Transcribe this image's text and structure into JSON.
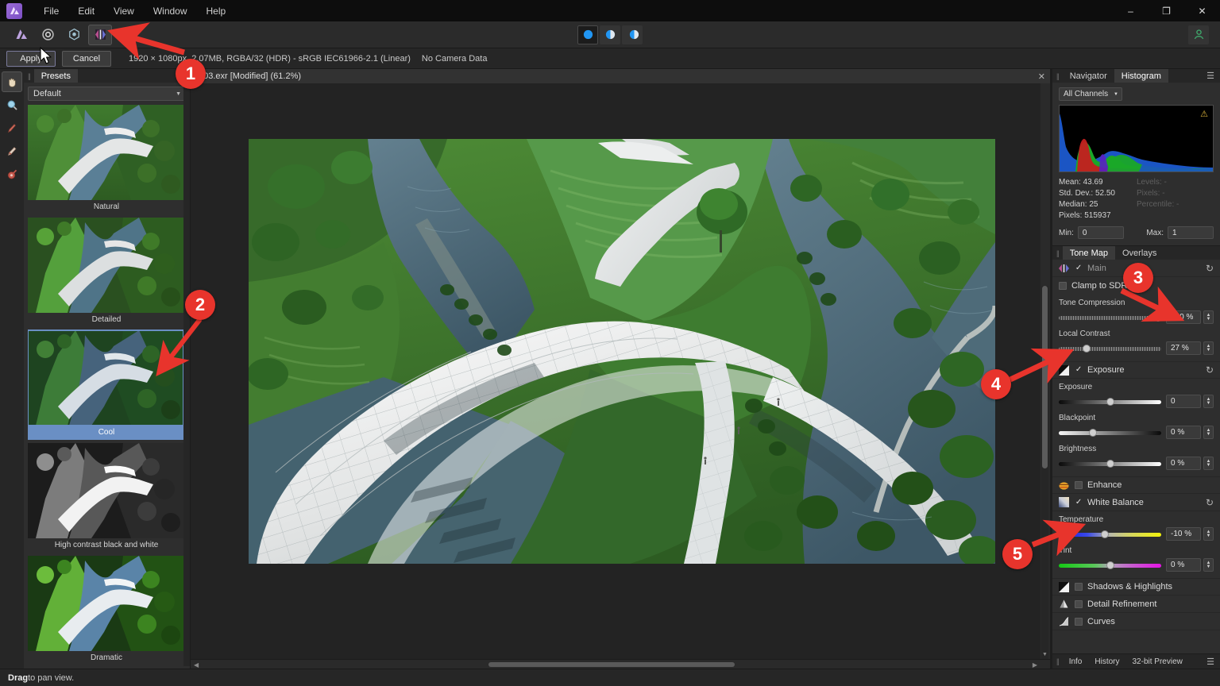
{
  "app": {
    "title": "Affinity Photo",
    "logo_icon": "affinity-photo-logo"
  },
  "menubar": {
    "items": [
      {
        "label": "File"
      },
      {
        "label": "Edit"
      },
      {
        "label": "View"
      },
      {
        "label": "Window"
      },
      {
        "label": "Help"
      }
    ]
  },
  "window_controls": {
    "minimize": "–",
    "maximize": "❐",
    "close": "✕"
  },
  "toolbar": {
    "personas": [
      {
        "name": "photo-persona",
        "icon": "affinity-persona-icon",
        "active": false
      },
      {
        "name": "liquify-persona",
        "icon": "liquify-persona-icon",
        "active": false
      },
      {
        "name": "develop-persona",
        "icon": "develop-persona-icon",
        "active": false
      },
      {
        "name": "tone-mapping-persona",
        "icon": "tone-mapping-persona-icon",
        "active": true
      },
      {
        "name": "export-persona",
        "icon": "export-persona-icon",
        "active": false
      }
    ],
    "view_modes": [
      {
        "name": "single-view",
        "icon": "single-view-icon",
        "active": true
      },
      {
        "name": "split-view",
        "icon": "split-view-icon",
        "active": false
      },
      {
        "name": "mirror-view",
        "icon": "mirror-view-icon",
        "active": false
      }
    ],
    "account_icon": "account-person-icon"
  },
  "context_bar": {
    "apply_label": "Apply",
    "cancel_label": "Cancel",
    "doc_meta": "1920 × 1080px, 2.07MB, RGBA/32 (HDR) - sRGB IEC61966-2.1 (Linear)",
    "camera_data": "No Camera Data"
  },
  "document_tab": {
    "title": "g03.exr [Modified] (61.2%)",
    "close_icon": "close-icon"
  },
  "tools": [
    {
      "name": "hand-tool",
      "icon": "hand-icon",
      "glyph": "✋",
      "active": true
    },
    {
      "name": "zoom-tool",
      "icon": "magnifier-icon",
      "glyph": "🔍",
      "active": false
    },
    {
      "name": "overlay-paint-tool",
      "icon": "overlay-paint-icon",
      "glyph": "🖌",
      "active": false
    },
    {
      "name": "overlay-erase-tool",
      "icon": "overlay-erase-icon",
      "glyph": "🖍",
      "active": false
    },
    {
      "name": "overlay-gradient-tool",
      "icon": "overlay-gradient-icon",
      "glyph": "🎨",
      "active": false
    }
  ],
  "presets_panel": {
    "tab_label": "Presets",
    "category": "Default",
    "category_caret": "▼",
    "items": [
      {
        "label": "Natural",
        "selected": false,
        "style": "natural"
      },
      {
        "label": "Detailed",
        "selected": false,
        "style": "detailed"
      },
      {
        "label": "Cool",
        "selected": true,
        "style": "cool"
      },
      {
        "label": "High contrast black and white",
        "selected": false,
        "style": "bw"
      },
      {
        "label": "Dramatic",
        "selected": false,
        "style": "dramatic"
      }
    ]
  },
  "canvas": {
    "image_description": "Aerial render of a white curved pedestrian bridge over a river with green parkland"
  },
  "histogram_panel": {
    "tabs": [
      {
        "label": "Navigator",
        "active": false
      },
      {
        "label": "Histogram",
        "active": true
      }
    ],
    "menu_icon": "panel-menu-icon",
    "channel": "All Channels",
    "channel_caret": "▼",
    "warning_icon": "clipping-warning-icon",
    "stats": [
      {
        "label": "Mean:",
        "value": "43.69"
      },
      {
        "label": "Std. Dev.:",
        "value": "52.50"
      },
      {
        "label": "Median:",
        "value": "25"
      },
      {
        "label": "Pixels:",
        "value": "515937"
      }
    ],
    "stats_right": [
      {
        "text": "Levels: -"
      },
      {
        "text": "Pixels: -"
      },
      {
        "text": "Percentile: -"
      }
    ],
    "min_label": "Min:",
    "min_value": "0",
    "max_label": "Max:",
    "max_value": "1"
  },
  "tonemap_panel": {
    "tabs": [
      {
        "label": "Tone Map",
        "active": true
      },
      {
        "label": "Overlays",
        "active": false
      }
    ],
    "main": {
      "icon": "tone-map-icon",
      "label": "Main",
      "checked": true,
      "reset_icon": "reset-icon"
    },
    "clamp_to_sdr": {
      "label": "Clamp to SDR",
      "checked": false
    },
    "tone_compression": {
      "label": "Tone Compression",
      "value": "100 %",
      "pct": 97
    },
    "local_contrast": {
      "label": "Local Contrast",
      "value": "27 %",
      "pct": 27
    },
    "exposure_section": {
      "icon": "exposure-icon",
      "label": "Exposure",
      "checked": true,
      "reset_icon": "reset-icon"
    },
    "exposure": {
      "label": "Exposure",
      "value": "0",
      "pct": 50
    },
    "blackpoint": {
      "label": "Blackpoint",
      "value": "0 %",
      "pct": 33
    },
    "brightness": {
      "label": "Brightness",
      "value": "0 %",
      "pct": 50
    },
    "enhance_section": {
      "icon": "enhance-icon",
      "label": "Enhance",
      "checked": false
    },
    "white_balance_section": {
      "icon": "white-balance-icon",
      "label": "White Balance",
      "checked": true,
      "reset_icon": "reset-icon"
    },
    "temperature": {
      "label": "Temperature",
      "value": "-10 %",
      "pct": 45
    },
    "tint": {
      "label": "Tint",
      "value": "0 %",
      "pct": 50
    },
    "shadows_highlights": {
      "icon": "shadows-highlights-icon",
      "label": "Shadows & Highlights",
      "checked": false
    },
    "detail_refinement": {
      "icon": "detail-refinement-icon",
      "label": "Detail Refinement",
      "checked": false
    },
    "curves": {
      "icon": "curves-icon",
      "label": "Curves",
      "checked": false
    }
  },
  "bottom_panel_tabs": {
    "tabs": [
      {
        "label": "Info",
        "active": false
      },
      {
        "label": "History",
        "active": false
      },
      {
        "label": "32-bit Preview",
        "active": false
      }
    ],
    "menu_icon": "panel-menu-icon"
  },
  "statusbar": {
    "bold": "Drag",
    "text": " to pan view."
  },
  "annotations": [
    {
      "number": "1",
      "target": "export-persona-icon"
    },
    {
      "number": "2",
      "target": "cool-preset"
    },
    {
      "number": "3",
      "target": "tone-compression-slider"
    },
    {
      "number": "4",
      "target": "exposure-section"
    },
    {
      "number": "5",
      "target": "temperature-slider"
    }
  ],
  "colors": {
    "accent_red": "#e8342c",
    "selection_blue": "#6a8fc4",
    "panel_bg": "#2e2e2e",
    "toolbar_bg": "#2b2b2b",
    "titlebar_bg": "#0d0d0d"
  }
}
